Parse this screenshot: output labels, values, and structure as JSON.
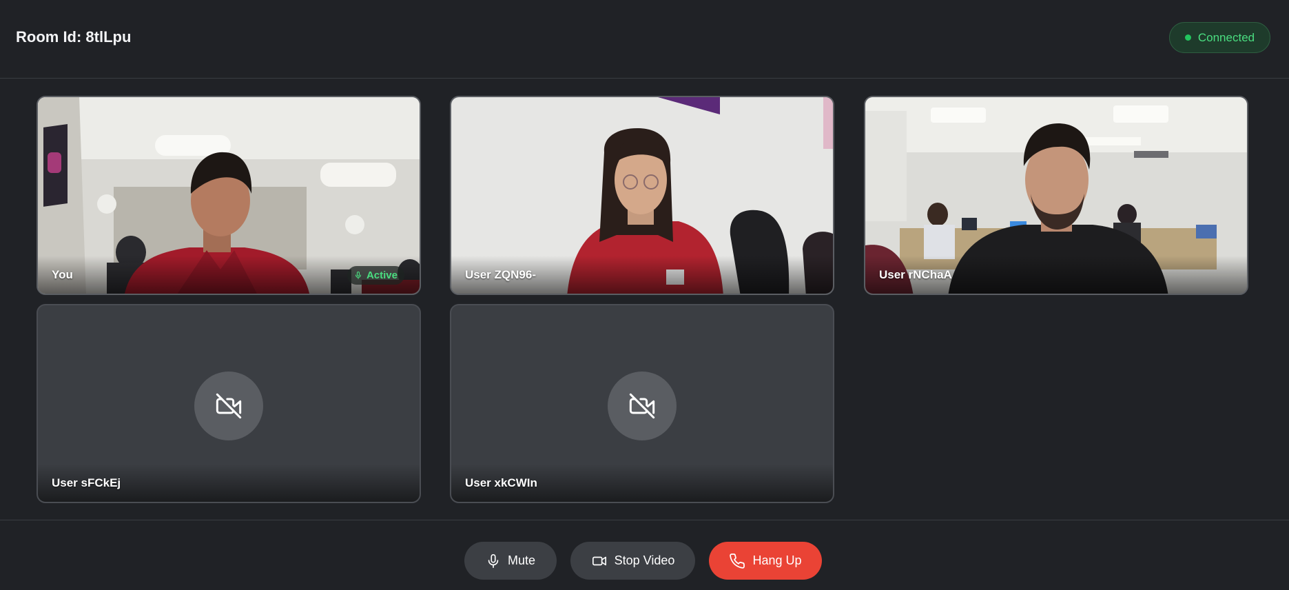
{
  "header": {
    "room_id": "Room Id: 8tlLpu",
    "status": "Connected"
  },
  "participants": [
    {
      "name": "You",
      "video": "on",
      "badge": "Active"
    },
    {
      "name": "User ZQN96-",
      "video": "on"
    },
    {
      "name": "User rNChaA",
      "video": "on"
    },
    {
      "name": "User sFCkEj",
      "video": "off"
    },
    {
      "name": "User xkCWIn",
      "video": "off"
    }
  ],
  "controls": {
    "mute": "Mute",
    "stop_video": "Stop Video",
    "hang_up": "Hang Up"
  },
  "colors": {
    "background": "#202226",
    "tile": "#3b3e43",
    "connected": "#4ade80",
    "hang_up": "#ea4335"
  },
  "icons": [
    "mic-icon",
    "video-camera-icon",
    "video-off-icon",
    "phone-icon"
  ]
}
